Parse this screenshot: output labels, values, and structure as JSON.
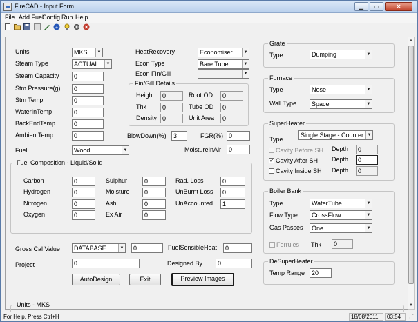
{
  "window": {
    "title": "FireCAD - Input Form"
  },
  "menu": [
    "File",
    "Add Fuel",
    "Config",
    "Run",
    "Help"
  ],
  "toolbar": {
    "icons": [
      "new-icon",
      "open-icon",
      "save-icon",
      "tools-icon",
      "help-circle-icon",
      "lightbulb-icon",
      "gear-icon",
      "stop-icon"
    ]
  },
  "general": {
    "units": {
      "label": "Units",
      "value": "MKS"
    },
    "steam_type": {
      "label": "Steam Type",
      "value": "ACTUAL"
    },
    "steam_capacity": {
      "label": "Steam Capacity",
      "value": "0"
    },
    "stm_pressure": {
      "label": "Stm Pressure(g)",
      "value": "0"
    },
    "stm_temp": {
      "label": "Stm Temp",
      "value": "0"
    },
    "water_in_temp": {
      "label": "WaterInTemp",
      "value": "0"
    },
    "back_end_temp": {
      "label": "BackEndTemp",
      "value": "0"
    },
    "ambient_temp": {
      "label": "AmbientTemp",
      "value": "0"
    },
    "fuel": {
      "label": "Fuel",
      "value": "Wood"
    },
    "heat_recovery": {
      "label": "HeatRecovery",
      "value": "Economiser"
    },
    "econ_type": {
      "label": "Econ Type",
      "value": "Bare Tube"
    },
    "econ_fin_gill": {
      "label": "Econ Fin/Gill",
      "value": ""
    },
    "blowdown": {
      "label": "BlowDown(%)",
      "value": "3"
    },
    "fgr": {
      "label": "FGR(%)",
      "value": "0"
    },
    "moisture_in_air": {
      "label": "MoistureInAir",
      "value": "0"
    }
  },
  "fin_gill": {
    "title": "Fin/Gill Details",
    "height": {
      "label": "Height",
      "value": "0"
    },
    "thk": {
      "label": "Thk",
      "value": "0"
    },
    "density": {
      "label": "Density",
      "value": "0"
    },
    "root_od": {
      "label": "Root OD",
      "value": "0"
    },
    "tube_od": {
      "label": "Tube OD",
      "value": "0"
    },
    "unit_area": {
      "label": "Unit Area",
      "value": "0"
    }
  },
  "fuel_comp": {
    "title": "Fuel Composition - Liquid/Solid",
    "carbon": {
      "label": "Carbon",
      "value": "0"
    },
    "hydrogen": {
      "label": "Hydrogen",
      "value": "0"
    },
    "nitrogen": {
      "label": "Nitrogen",
      "value": "0"
    },
    "oxygen": {
      "label": "Oxygen",
      "value": "0"
    },
    "sulphur": {
      "label": "Sulphur",
      "value": "0"
    },
    "moisture": {
      "label": "Moisture",
      "value": "0"
    },
    "ash": {
      "label": "Ash",
      "value": "0"
    },
    "ex_air": {
      "label": "Ex Air",
      "value": "0"
    },
    "rad_loss": {
      "label": "Rad. Loss",
      "value": "0"
    },
    "unburnt_loss": {
      "label": "UnBurnt Loss",
      "value": "0"
    },
    "unaccounted": {
      "label": "UnAccounted",
      "value": "1"
    }
  },
  "bottom": {
    "gcv": {
      "label": "Gross Cal Value",
      "value": "DATABASE",
      "num": "0"
    },
    "fuel_sensible_heat": {
      "label": "FuelSensibleHeat",
      "value": "0"
    },
    "project": {
      "label": "Project",
      "value": "0"
    },
    "designed_by": {
      "label": "Designed By",
      "value": "0"
    }
  },
  "buttons": {
    "auto_design": "AutoDesign",
    "exit": "Exit",
    "preview_images": "Preview Images"
  },
  "grate": {
    "title": "Grate",
    "type_label": "Type",
    "type_value": "Dumping"
  },
  "furnace": {
    "title": "Furnace",
    "type_label": "Type",
    "type_value": "Nose",
    "wall_label": "Wall Type",
    "wall_value": "Space"
  },
  "superheater": {
    "title": "SuperHeater",
    "type_label": "Type",
    "type_value": "Single Stage - Counter",
    "cavity_before": {
      "label": "Cavity Before SH",
      "checked": false,
      "depth_label": "Depth",
      "depth": "0"
    },
    "cavity_after": {
      "label": "Cavity After SH",
      "checked": true,
      "depth_label": "Depth",
      "depth": "0"
    },
    "cavity_inside": {
      "label": "Cavity Inside SH",
      "checked": false,
      "depth_label": "Depth",
      "depth": "0"
    }
  },
  "boiler_bank": {
    "title": "Boiler Bank",
    "type_label": "Type",
    "type_value": "WaterTube",
    "flow_label": "Flow Type",
    "flow_value": "CrossFlow",
    "passes_label": "Gas Passes",
    "passes_value": "One",
    "ferrules_label": "Ferrules",
    "thk_label": "Thk",
    "thk_value": "0"
  },
  "desuperheater": {
    "title": "DeSuperHeater",
    "temp_label": "Temp Range",
    "temp_value": "20"
  },
  "units_group": {
    "title": "Units - MKS"
  },
  "status": {
    "help": "For Help, Press Ctrl+H",
    "date": "18/08/2011",
    "time": "03:54"
  },
  "colors": {
    "accent_blue": "#3a6fc2",
    "stop_red": "#c0392b"
  }
}
